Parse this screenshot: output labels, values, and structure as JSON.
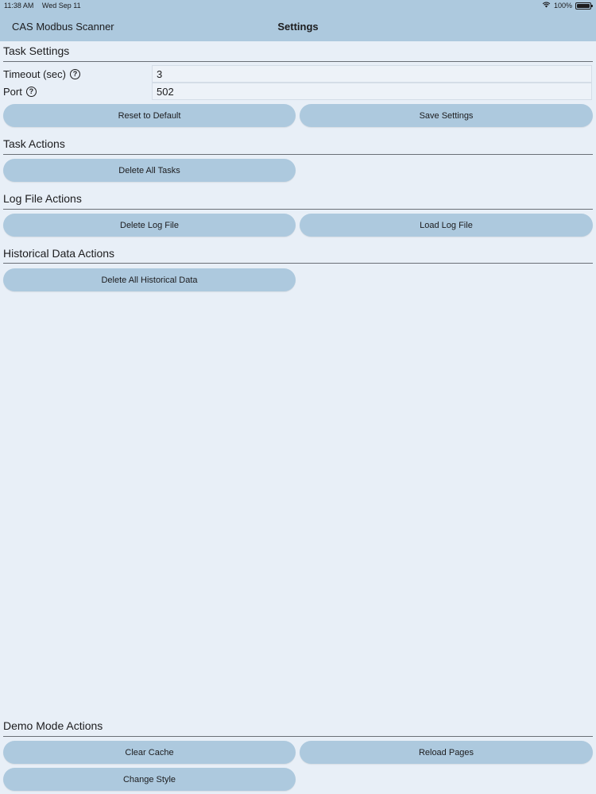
{
  "status_bar": {
    "time": "11:38 AM",
    "date": "Wed Sep 11",
    "battery": "100%"
  },
  "nav": {
    "app_name": "CAS Modbus Scanner",
    "title": "Settings"
  },
  "task_settings": {
    "title": "Task Settings",
    "timeout_label": "Timeout (sec)",
    "timeout_value": "3",
    "port_label": "Port",
    "port_value": "502",
    "reset_label": "Reset to Default",
    "save_label": "Save Settings"
  },
  "task_actions": {
    "title": "Task Actions",
    "delete_all_label": "Delete All Tasks"
  },
  "log_file_actions": {
    "title": "Log File Actions",
    "delete_label": "Delete Log File",
    "load_label": "Load Log File"
  },
  "historical_data_actions": {
    "title": "Historical Data Actions",
    "delete_all_label": "Delete All Historical Data"
  },
  "demo_mode_actions": {
    "title": "Demo Mode Actions",
    "clear_cache_label": "Clear Cache",
    "reload_pages_label": "Reload Pages",
    "change_style_label": "Change Style"
  }
}
